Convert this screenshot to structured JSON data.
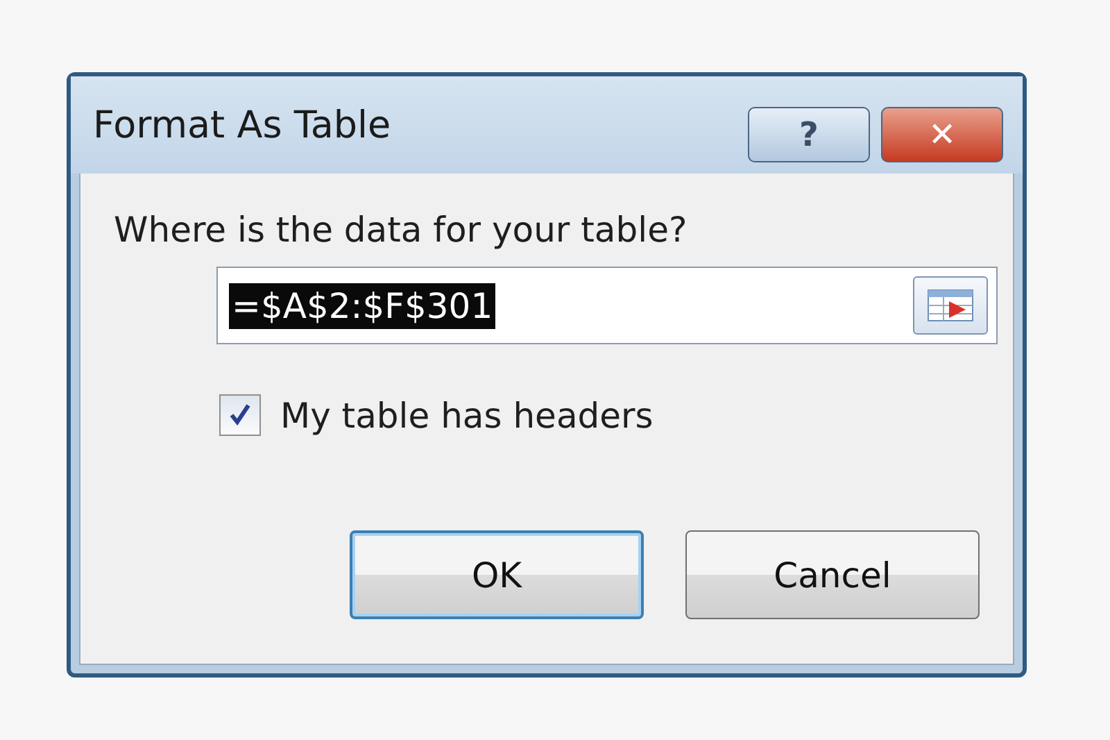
{
  "window": {
    "title": "Format As Table"
  },
  "title_buttons": [
    {
      "kind": "help",
      "label": "?"
    },
    {
      "kind": "close",
      "label": "✕"
    }
  ],
  "range_prompt": "Where is the data for your table?",
  "range_field": {
    "value": "=$A$2:$F$301",
    "selected": true
  },
  "headers_checkbox": {
    "label": "My table has headers",
    "checked": true
  },
  "buttons": [
    {
      "label": "OK",
      "focused": true
    },
    {
      "label": "Cancel",
      "focused": false
    }
  ]
}
